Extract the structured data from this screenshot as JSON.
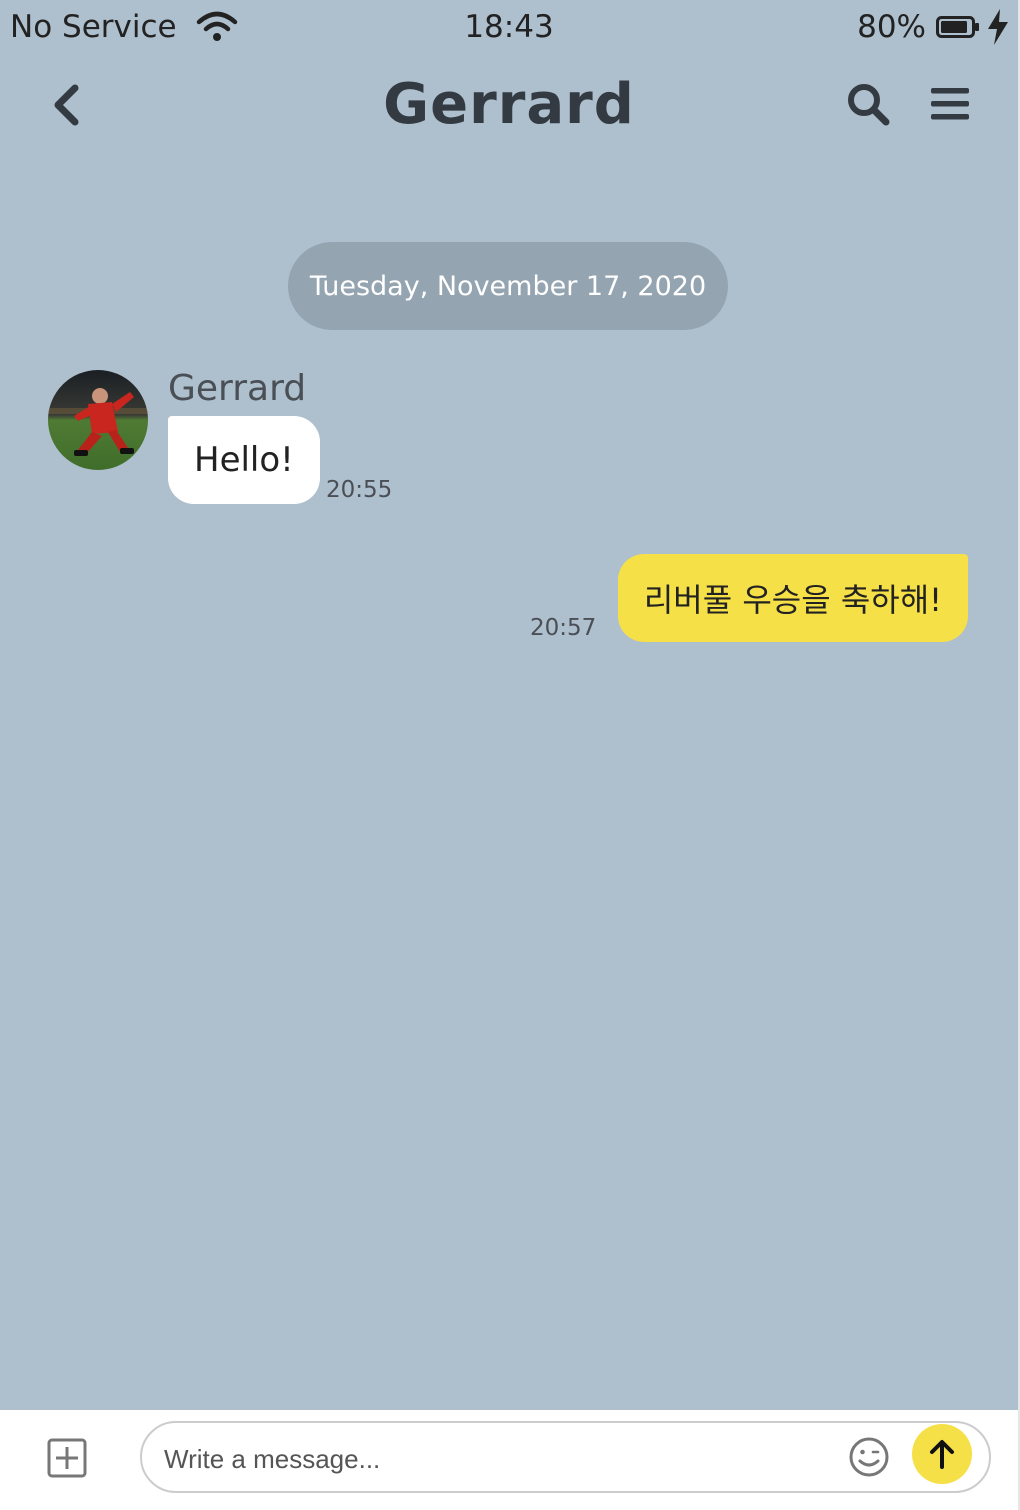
{
  "status_bar": {
    "carrier": "No Service",
    "time": "18:43",
    "battery": "80%",
    "icons": [
      "wifi-icon",
      "battery-icon",
      "charging-bolt-icon"
    ]
  },
  "header": {
    "title": "Gerrard",
    "icons": [
      "chevron-left-icon",
      "search-icon",
      "hamburger-menu-icon"
    ]
  },
  "conversation": {
    "date": "Tuesday, November 17, 2020",
    "messages": [
      {
        "direction": "incoming",
        "sender": "Gerrard",
        "text": "Hello!",
        "time": "20:55"
      },
      {
        "direction": "outgoing",
        "text": "리버풀 우승을 축하해!",
        "time": "20:57"
      }
    ]
  },
  "composer": {
    "placeholder": "Write a message...",
    "icons": [
      "add-square-icon",
      "emoji-icon",
      "arrow-up-icon"
    ]
  },
  "colors": {
    "background": "#aebfce",
    "date_pill": "#95a4b1",
    "incoming_bubble": "#ffffff",
    "outgoing_bubble": "#f6e047",
    "send_button": "#f6e047",
    "title_text": "#333a42"
  }
}
